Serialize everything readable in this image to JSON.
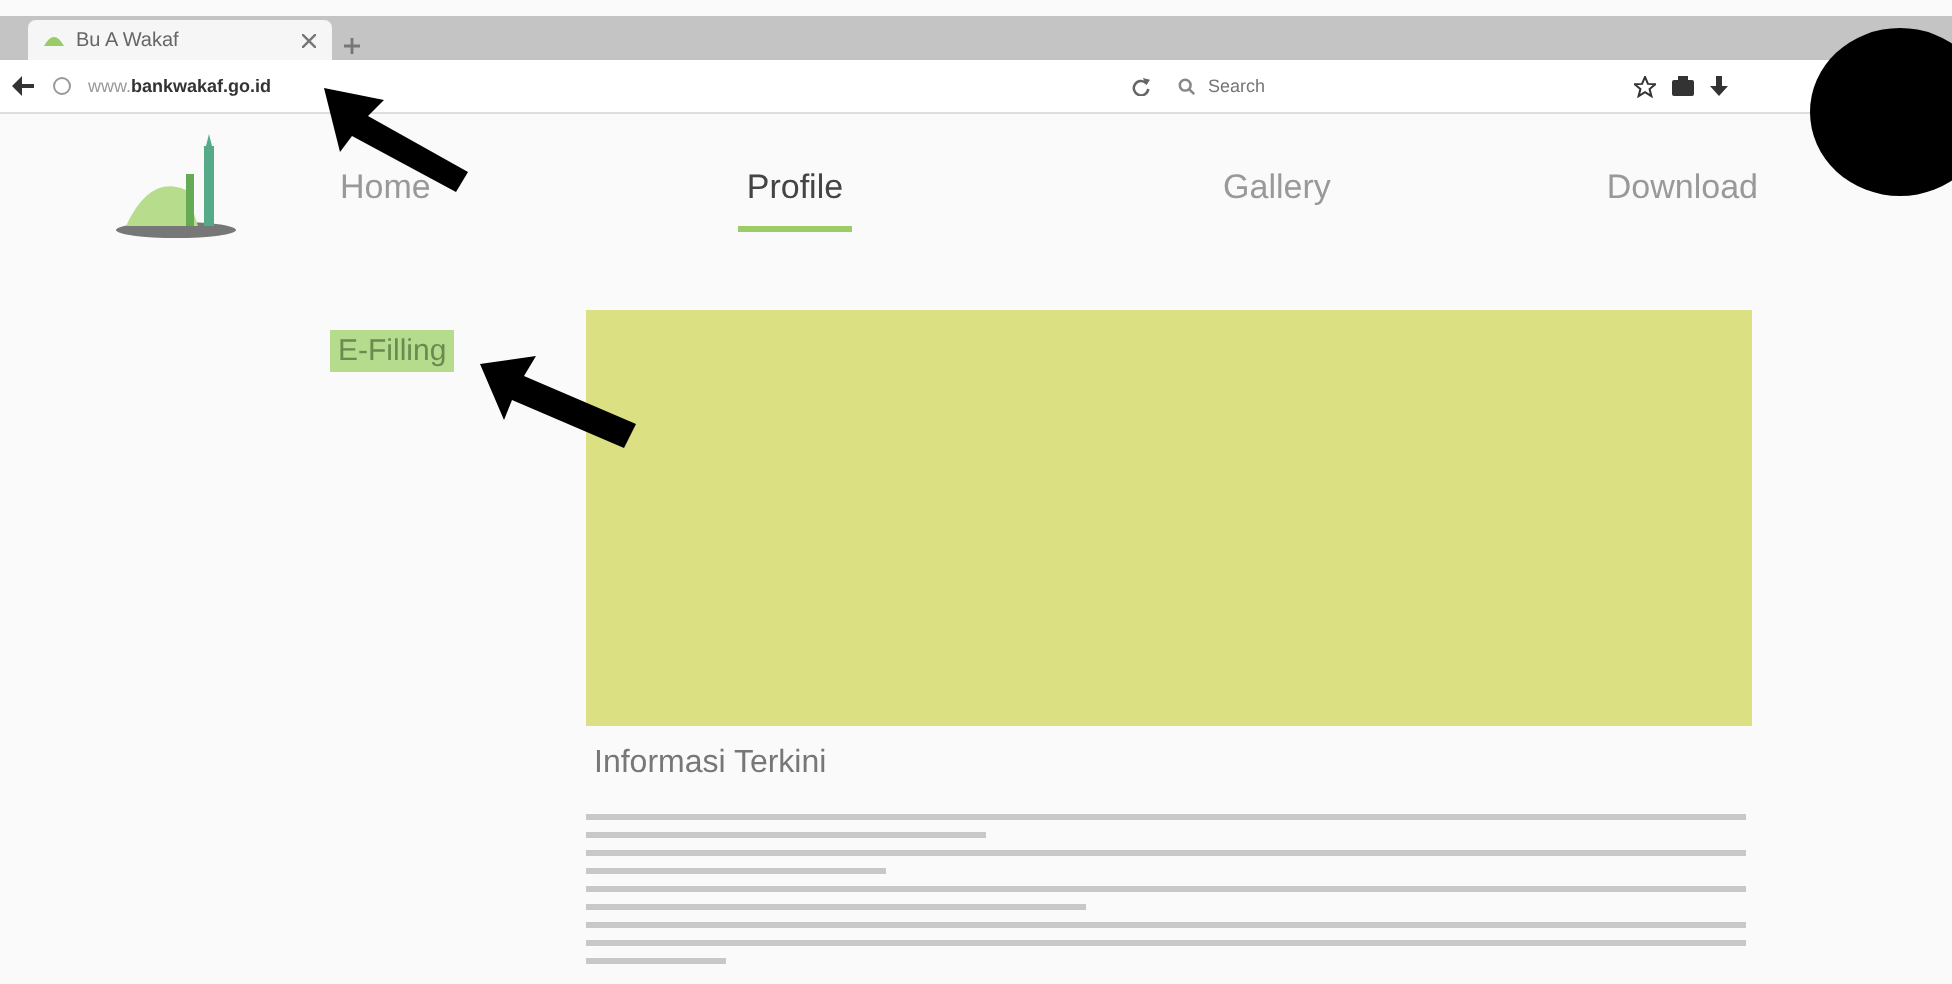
{
  "browser": {
    "tab_title": "Bu A Wakaf",
    "url_prefix": "www.",
    "url_domain": "bankwakaf.go.id",
    "search": {
      "placeholder": "Search"
    }
  },
  "nav": [
    {
      "label": "Home",
      "selected": false
    },
    {
      "label": "Profile",
      "selected": true
    },
    {
      "label": "Gallery",
      "selected": false
    },
    {
      "label": "Download",
      "selected": false
    }
  ],
  "side_menu": [
    {
      "label": "E-Filling",
      "selected": true
    }
  ],
  "section_title": "Informasi Terkini"
}
